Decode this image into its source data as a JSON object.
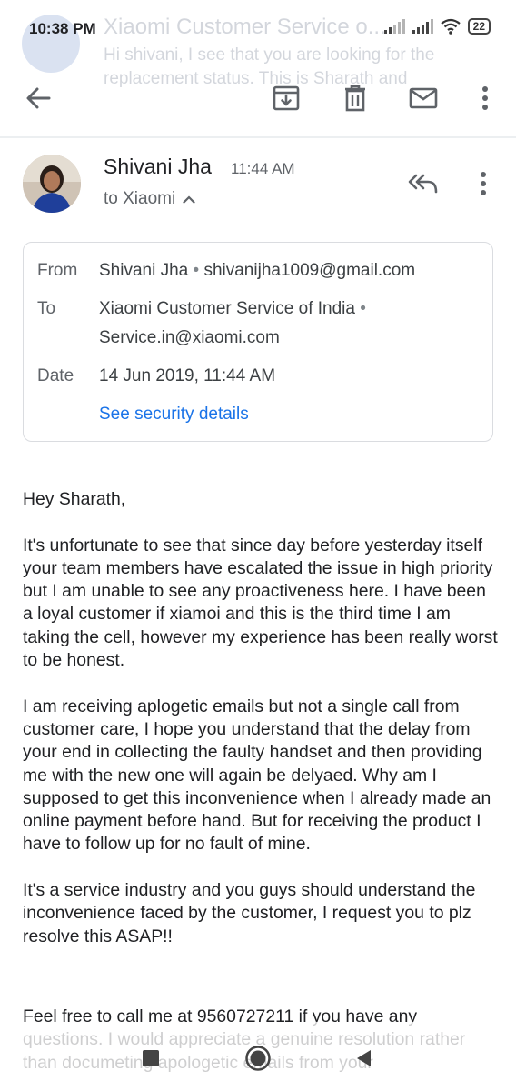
{
  "status_bar": {
    "time": "10:38 PM",
    "battery": "22",
    "icons": [
      "signal-icon",
      "signal-icon",
      "wifi-icon",
      "battery-icon"
    ]
  },
  "notification": {
    "title": "Xiaomi Customer Service o...",
    "text": "Hi shivani, I see that you are looking for the replacement status. This is Sharath and"
  },
  "toolbar": {
    "icons": [
      "back-arrow-icon",
      "archive-icon",
      "delete-icon",
      "mark-unread-icon",
      "more-vert-icon"
    ]
  },
  "message": {
    "sender_name": "Shivani Jha",
    "time": "11:44 AM",
    "to_line": "to Xiaomi",
    "details": {
      "from_label": "From",
      "from_name": "Shivani Jha",
      "from_email": "shivanijha1009@gmail.com",
      "to_label": "To",
      "to_name": "Xiaomi Customer Service of India",
      "to_email": "Service.in@xiaomi.com",
      "date_label": "Date",
      "date_value": "14 Jun 2019, 11:44 AM",
      "security_link": "See security details",
      "separator": "•"
    },
    "body": [
      "Hey Sharath,",
      "It's unfortunate to see that since day before yesterday itself your team members have escalated the issue in high priority but I am unable to see any proactiveness here.  I have been a loyal customer if xiamoi and this is the third time I am taking the cell,  however my experience has been really worst to be honest.",
      "I am receiving aplogetic emails but not a single call from customer care,  I hope you understand that the delay from your end in collecting the faulty handset and then providing me with the new one will again be delyaed.  Why am I supposed to get this inconvenience when I already made an online payment before hand.  But for receiving the product I have to follow up for no fault of mine.",
      "It's a service industry and you guys should understand the inconvenience faced by the customer,  I request you to plz resolve this ASAP!!",
      "Feel free to call me at 9560727211 if you have any questions.  I would appreciate a genuine resolution rather than documeting apologetic emails from your"
    ]
  },
  "nav_bar": {
    "icons": [
      "recents-square-icon",
      "home-circle-icon",
      "back-triangle-icon"
    ]
  },
  "colors": {
    "link": "#1a73e8",
    "secondary_text": "#5f6368",
    "card_border": "#dadce0"
  }
}
